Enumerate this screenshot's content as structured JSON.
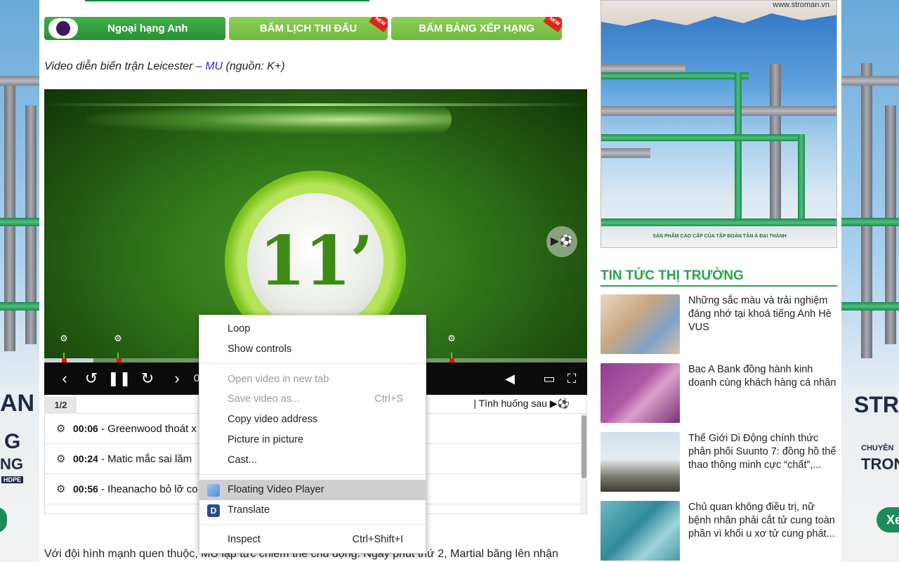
{
  "nav_buttons": {
    "premier_league": "Ngoại hạng Anh",
    "schedule": "BẤM LỊCH THI ĐẤU",
    "standings": "BẤM BẢNG XẾP HẠNG",
    "new_badge": "NEW"
  },
  "caption": {
    "prefix": "Video diễn biến trận Leicester – ",
    "link": "MU",
    "suffix": " (nguồn: K+)"
  },
  "video": {
    "minute_display": "11’",
    "time_fragment": "0"
  },
  "events": {
    "page": "1/2",
    "next_label": "Tình huống sau",
    "rows": [
      {
        "time": "00:06",
        "text": "Greenwood thoát x"
      },
      {
        "time": "00:24",
        "text": "Matic mắc sai lầm"
      },
      {
        "time": "00:56",
        "text": "Iheanacho bỏ lỡ co"
      }
    ]
  },
  "context_menu": {
    "items": [
      {
        "label": "Loop",
        "disabled": false
      },
      {
        "label": "Show controls",
        "disabled": false
      },
      {
        "label": "Open video in new tab",
        "disabled": true
      },
      {
        "label": "Save video as...",
        "disabled": true,
        "shortcut": "Ctrl+S"
      },
      {
        "label": "Copy video address",
        "disabled": false
      },
      {
        "label": "Picture in picture",
        "disabled": false
      },
      {
        "label": "Cast...",
        "disabled": false
      },
      {
        "label": "Floating Video Player",
        "disabled": false,
        "highlighted": true
      },
      {
        "label": "Translate",
        "disabled": false
      },
      {
        "label": "Inspect",
        "disabled": false,
        "shortcut": "Ctrl+Shift+I"
      }
    ]
  },
  "paragraph": "Với đội hình mạnh quen thuộc, MU lập tức chiếm thế chủ động. Ngay phút thứ 2, Martial băng lên nhận",
  "right_ad": {
    "site": "www.stroman.vn",
    "footer": "SẢN PHẨM CAO CẤP CỦA TẬP ĐOÀN TÂN Á ĐẠI THÀNH"
  },
  "news": {
    "title": "TIN TỨC THỊ TRƯỜNG",
    "items": [
      {
        "text": "Những sắc màu và trải nghiệm đáng nhớ tại khoá tiếng Anh Hè VUS"
      },
      {
        "text": "Bac A Bank đồng hành kinh doanh cùng khách hàng cá nhân"
      },
      {
        "text": "Thế Giới Di Động chính thức phân phối Suunto 7: đồng hồ thể thao thông minh cực “chất”,..."
      },
      {
        "text": "Chủ quan không điều trị, nữ bệnh nhân phải cắt tử cung toàn phần vì khối u xơ tử cung phát..."
      }
    ]
  },
  "side_ads": {
    "left_lines": [
      "AN",
      "G",
      "NG",
      "HDPE"
    ],
    "right_lines": [
      "STR",
      "CHUYÊN",
      "TRON",
      "Xe"
    ]
  },
  "colors": {
    "accent_green": "#2aa34b",
    "link_blue": "#2a2ae0",
    "event_marker_red": "#ee1111"
  }
}
